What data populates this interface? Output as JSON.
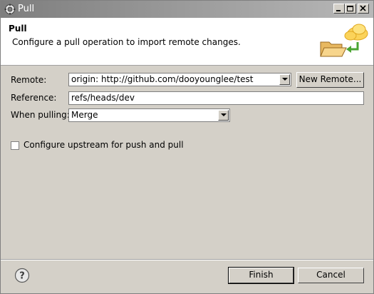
{
  "window": {
    "title": "Pull"
  },
  "header": {
    "title": "Pull",
    "description": "Configure a pull operation to import remote changes."
  },
  "form": {
    "remote_label": "Remote:",
    "remote_value": "origin: http://github.com/dooyounglee/test",
    "new_remote_label": "New Remote...",
    "reference_label": "Reference:",
    "reference_value": "refs/heads/dev",
    "when_pulling_label": "When pulling:",
    "when_pulling_value": "Merge",
    "upstream_label": "Configure upstream for push and pull",
    "upstream_checked": false
  },
  "footer": {
    "finish_label": "Finish",
    "cancel_label": "Cancel"
  },
  "icons": {
    "app": "gear-icon",
    "help": "help-icon",
    "banner": "pull-folder-cloud-icon"
  }
}
